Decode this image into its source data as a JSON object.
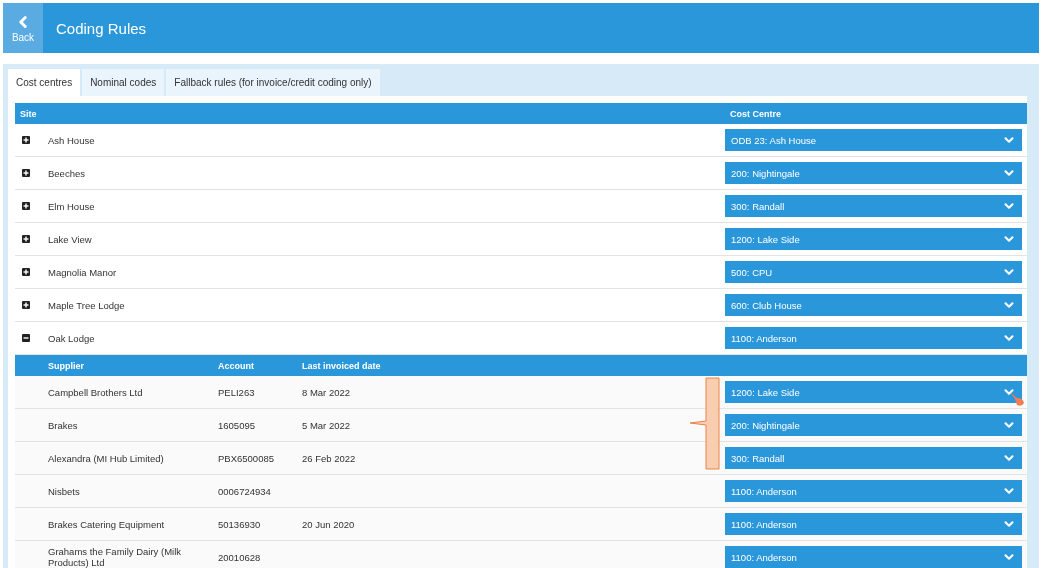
{
  "header": {
    "back_label": "Back",
    "title": "Coding Rules"
  },
  "tabs": [
    {
      "label": "Cost centres",
      "selected": true
    },
    {
      "label": "Nominal codes",
      "selected": false
    },
    {
      "label": "Fallback rules (for invoice/credit coding only)",
      "selected": false
    }
  ],
  "table": {
    "columns": [
      "Site",
      "Cost Centre"
    ],
    "supplier_columns": [
      "Supplier",
      "Account",
      "Last invoiced date"
    ],
    "sites": [
      {
        "name": "Ash House",
        "expanded": false,
        "cost_centre": "ODB 23: Ash House"
      },
      {
        "name": "Beeches",
        "expanded": false,
        "cost_centre": "200: Nightingale"
      },
      {
        "name": "Elm House",
        "expanded": false,
        "cost_centre": "300: Randall"
      },
      {
        "name": "Lake View",
        "expanded": false,
        "cost_centre": "1200: Lake Side"
      },
      {
        "name": "Magnolia Manor",
        "expanded": false,
        "cost_centre": "500: CPU"
      },
      {
        "name": "Maple Tree Lodge",
        "expanded": false,
        "cost_centre": "600: Club House"
      },
      {
        "name": "Oak Lodge",
        "expanded": true,
        "cost_centre": "1100: Anderson",
        "suppliers": [
          {
            "supplier": "Campbell Brothers Ltd",
            "account": "PELI263",
            "last_invoiced": "8 Mar 2022",
            "cost_centre": "1200: Lake Side"
          },
          {
            "supplier": "Brakes",
            "account": "1605095",
            "last_invoiced": "5 Mar 2022",
            "cost_centre": "200: Nightingale"
          },
          {
            "supplier": "Alexandra (MI Hub Limited)",
            "account": "PBX6500085",
            "last_invoiced": "26 Feb 2022",
            "cost_centre": "300: Randall"
          },
          {
            "supplier": "Nisbets",
            "account": "0006724934",
            "cost_centre": "1100: Anderson"
          },
          {
            "supplier": "Brakes Catering Equipment",
            "account": "50136930",
            "last_invoiced": "20 Jun 2020",
            "cost_centre": "1100: Anderson"
          },
          {
            "supplier": "Grahams the Family Dairy (Milk Products) Ltd",
            "account": "20010628",
            "cost_centre": "1100: Anderson"
          }
        ]
      }
    ]
  }
}
